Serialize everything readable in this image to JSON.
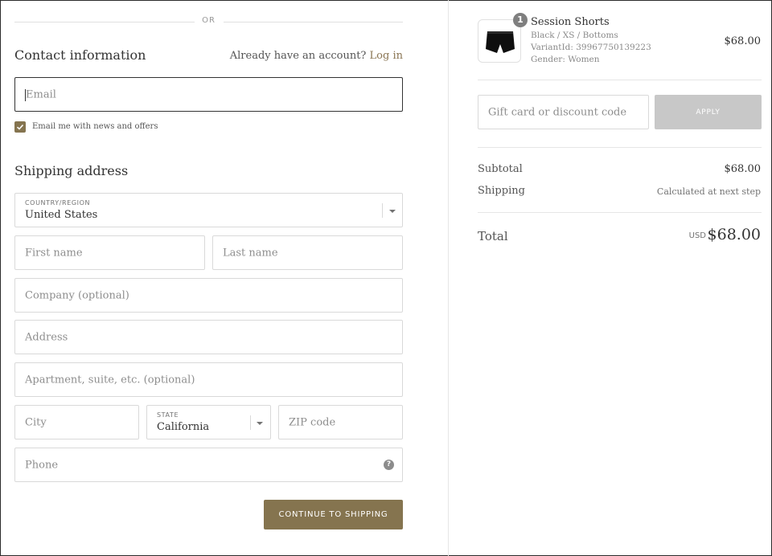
{
  "divider": {
    "or_label": "OR"
  },
  "contact": {
    "title": "Contact information",
    "account_prompt": "Already have an account?",
    "login_link": "Log in",
    "email_placeholder": "Email",
    "newsletter_label": "Email me with news and offers",
    "newsletter_checked": true
  },
  "shipping": {
    "title": "Shipping address",
    "country_label": "COUNTRY/REGION",
    "country_value": "United States",
    "first_name_placeholder": "First name",
    "last_name_placeholder": "Last name",
    "company_placeholder": "Company (optional)",
    "address_placeholder": "Address",
    "apartment_placeholder": "Apartment, suite, etc. (optional)",
    "city_placeholder": "City",
    "state_label": "STATE",
    "state_value": "California",
    "zip_placeholder": "ZIP code",
    "phone_placeholder": "Phone",
    "help_symbol": "?",
    "continue_label": "CONTINUE TO SHIPPING"
  },
  "summary": {
    "product": {
      "quantity": "1",
      "name": "Session Shorts",
      "variant": "Black / XS / Bottoms",
      "variant_id": "VariantId: 39967750139223",
      "gender": "Gender: Women",
      "price": "$68.00"
    },
    "discount_placeholder": "Gift card or discount code",
    "apply_label": "APPLY",
    "subtotal_label": "Subtotal",
    "subtotal_value": "$68.00",
    "shipping_label": "Shipping",
    "shipping_value": "Calculated at next step",
    "total_label": "Total",
    "total_currency": "USD",
    "total_value": "$68.00"
  },
  "colors": {
    "accent": "#85744f",
    "link": "#8a7553",
    "apply_disabled": "#c8c8c8"
  }
}
